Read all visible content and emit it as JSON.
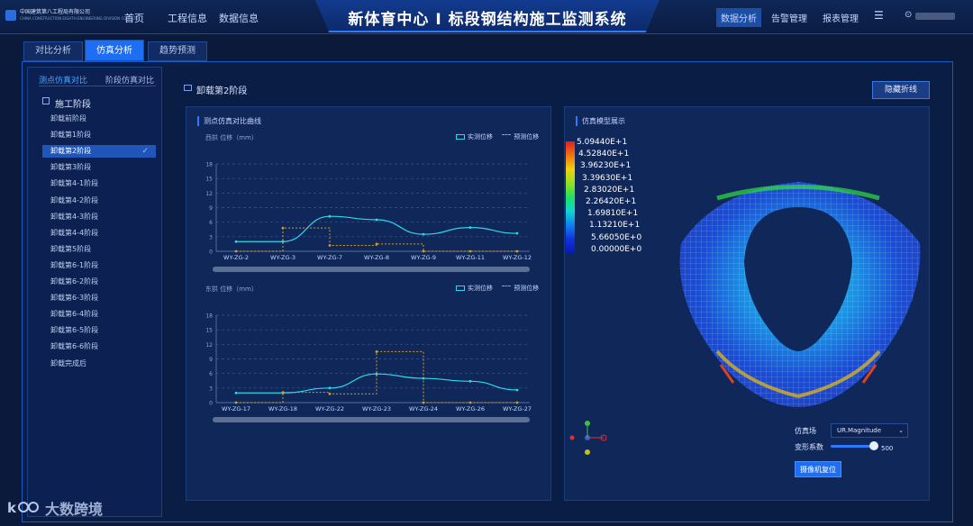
{
  "header": {
    "logo_title": "中国建筑第八工程局有限公司",
    "logo_subtitle": "CHINA CONSTRUCTION EIGHTH ENGINEERING DIVISION CORP.LTD",
    "nav": [
      "首页",
      "工程信息",
      "数据信息"
    ],
    "title": "新体育中心 I 标段钢结构施工监测系统",
    "right_nav": [
      "数据分析",
      "告警管理",
      "报表管理"
    ],
    "active_right_nav": "数据分析"
  },
  "tabs": [
    "对比分析",
    "仿真分析",
    "趋势预测"
  ],
  "active_tab": "仿真分析",
  "sidebar": {
    "sub_tabs": [
      "测点仿真对比",
      "阶段仿真对比"
    ],
    "section_title": "施工阶段",
    "items": [
      "卸载前阶段",
      "卸载第1阶段",
      "卸载第2阶段",
      "卸载第3阶段",
      "卸载第4-1阶段",
      "卸载第4-2阶段",
      "卸载第4-3阶段",
      "卸载第4-4阶段",
      "卸载第5阶段",
      "卸载第6-1阶段",
      "卸载第6-2阶段",
      "卸载第6-3阶段",
      "卸载第6-4阶段",
      "卸载第6-5阶段",
      "卸载第6-6阶段",
      "卸载完成后"
    ],
    "active_item": "卸载第2阶段"
  },
  "content": {
    "header": "卸载第2阶段",
    "hide_button": "隐藏折线",
    "left_panel_title": "测点仿真对比曲线",
    "right_panel_title": "仿真模型展示"
  },
  "chart_data": [
    {
      "type": "line",
      "title": "",
      "ylabel": "西拱 位移（mm）",
      "ylim": [
        0,
        18
      ],
      "yticks": [
        0,
        3,
        6,
        9,
        12,
        15,
        18
      ],
      "categories": [
        "WY-ZG-2",
        "WY-ZG-3",
        "WY-ZG-7",
        "WY-ZG-8",
        "WY-ZG-9",
        "WY-ZG-11",
        "WY-ZG-12"
      ],
      "series": [
        {
          "name": "实测位移",
          "color": "#2dd8ea",
          "values": [
            2.0,
            2.0,
            7.2,
            6.5,
            3.5,
            4.9,
            3.7
          ]
        },
        {
          "name": "预测位移",
          "color": "#d2a020",
          "step": true,
          "values": [
            0.0,
            4.8,
            1.2,
            1.5,
            0.0,
            0.0,
            0.0
          ]
        }
      ]
    },
    {
      "type": "line",
      "title": "",
      "ylabel": "东拱 位移（mm）",
      "ylim": [
        0,
        18
      ],
      "yticks": [
        0,
        3,
        6,
        9,
        12,
        15,
        18
      ],
      "categories": [
        "WY-ZG-17",
        "WY-ZG-18",
        "WY-ZG-22",
        "WY-ZG-23",
        "WY-ZG-24",
        "WY-ZG-26",
        "WY-ZG-27"
      ],
      "series": [
        {
          "name": "实测位移",
          "color": "#2dd8ea",
          "values": [
            2.0,
            2.0,
            3.0,
            5.9,
            5.0,
            4.4,
            2.6
          ]
        },
        {
          "name": "预测位移",
          "color": "#d2a020",
          "step": true,
          "values": [
            0.0,
            2.1,
            1.8,
            10.5,
            0.0,
            0.0,
            0.0
          ]
        }
      ]
    }
  ],
  "colorbar": {
    "labels": [
      "5.09440E+1",
      "4.52840E+1",
      "3.96230E+1",
      "3.39630E+1",
      "2.83020E+1",
      "2.26420E+1",
      "1.69810E+1",
      "1.13210E+1",
      "5.66050E+0",
      "0.00000E+0"
    ]
  },
  "sim_controls": {
    "field_label": "仿真场",
    "field_value": "UR.Magnitude",
    "deform_label": "变形系数",
    "deform_value": "500",
    "camera_button": "摄像机复位"
  },
  "watermark": "大数跨境"
}
